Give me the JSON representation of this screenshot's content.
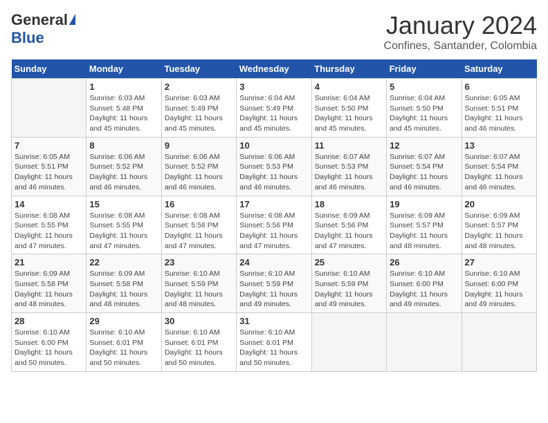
{
  "logo": {
    "general": "General",
    "blue": "Blue"
  },
  "title": "January 2024",
  "subtitle": "Confines, Santander, Colombia",
  "days_of_week": [
    "Sunday",
    "Monday",
    "Tuesday",
    "Wednesday",
    "Thursday",
    "Friday",
    "Saturday"
  ],
  "weeks": [
    [
      {
        "num": "",
        "info": ""
      },
      {
        "num": "1",
        "info": "Sunrise: 6:03 AM\nSunset: 5:48 PM\nDaylight: 11 hours\nand 45 minutes."
      },
      {
        "num": "2",
        "info": "Sunrise: 6:03 AM\nSunset: 5:49 PM\nDaylight: 11 hours\nand 45 minutes."
      },
      {
        "num": "3",
        "info": "Sunrise: 6:04 AM\nSunset: 5:49 PM\nDaylight: 11 hours\nand 45 minutes."
      },
      {
        "num": "4",
        "info": "Sunrise: 6:04 AM\nSunset: 5:50 PM\nDaylight: 11 hours\nand 45 minutes."
      },
      {
        "num": "5",
        "info": "Sunrise: 6:04 AM\nSunset: 5:50 PM\nDaylight: 11 hours\nand 45 minutes."
      },
      {
        "num": "6",
        "info": "Sunrise: 6:05 AM\nSunset: 5:51 PM\nDaylight: 11 hours\nand 46 minutes."
      }
    ],
    [
      {
        "num": "7",
        "info": "Sunrise: 6:05 AM\nSunset: 5:51 PM\nDaylight: 11 hours\nand 46 minutes."
      },
      {
        "num": "8",
        "info": "Sunrise: 6:06 AM\nSunset: 5:52 PM\nDaylight: 11 hours\nand 46 minutes."
      },
      {
        "num": "9",
        "info": "Sunrise: 6:06 AM\nSunset: 5:52 PM\nDaylight: 11 hours\nand 46 minutes."
      },
      {
        "num": "10",
        "info": "Sunrise: 6:06 AM\nSunset: 5:53 PM\nDaylight: 11 hours\nand 46 minutes."
      },
      {
        "num": "11",
        "info": "Sunrise: 6:07 AM\nSunset: 5:53 PM\nDaylight: 11 hours\nand 46 minutes."
      },
      {
        "num": "12",
        "info": "Sunrise: 6:07 AM\nSunset: 5:54 PM\nDaylight: 11 hours\nand 46 minutes."
      },
      {
        "num": "13",
        "info": "Sunrise: 6:07 AM\nSunset: 5:54 PM\nDaylight: 11 hours\nand 46 minutes."
      }
    ],
    [
      {
        "num": "14",
        "info": "Sunrise: 6:08 AM\nSunset: 5:55 PM\nDaylight: 11 hours\nand 47 minutes."
      },
      {
        "num": "15",
        "info": "Sunrise: 6:08 AM\nSunset: 5:55 PM\nDaylight: 11 hours\nand 47 minutes."
      },
      {
        "num": "16",
        "info": "Sunrise: 6:08 AM\nSunset: 5:56 PM\nDaylight: 11 hours\nand 47 minutes."
      },
      {
        "num": "17",
        "info": "Sunrise: 6:08 AM\nSunset: 5:56 PM\nDaylight: 11 hours\nand 47 minutes."
      },
      {
        "num": "18",
        "info": "Sunrise: 6:09 AM\nSunset: 5:56 PM\nDaylight: 11 hours\nand 47 minutes."
      },
      {
        "num": "19",
        "info": "Sunrise: 6:09 AM\nSunset: 5:57 PM\nDaylight: 11 hours\nand 48 minutes."
      },
      {
        "num": "20",
        "info": "Sunrise: 6:09 AM\nSunset: 5:57 PM\nDaylight: 11 hours\nand 48 minutes."
      }
    ],
    [
      {
        "num": "21",
        "info": "Sunrise: 6:09 AM\nSunset: 5:58 PM\nDaylight: 11 hours\nand 48 minutes."
      },
      {
        "num": "22",
        "info": "Sunrise: 6:09 AM\nSunset: 5:58 PM\nDaylight: 11 hours\nand 48 minutes."
      },
      {
        "num": "23",
        "info": "Sunrise: 6:10 AM\nSunset: 5:59 PM\nDaylight: 11 hours\nand 48 minutes."
      },
      {
        "num": "24",
        "info": "Sunrise: 6:10 AM\nSunset: 5:59 PM\nDaylight: 11 hours\nand 49 minutes."
      },
      {
        "num": "25",
        "info": "Sunrise: 6:10 AM\nSunset: 5:59 PM\nDaylight: 11 hours\nand 49 minutes."
      },
      {
        "num": "26",
        "info": "Sunrise: 6:10 AM\nSunset: 6:00 PM\nDaylight: 11 hours\nand 49 minutes."
      },
      {
        "num": "27",
        "info": "Sunrise: 6:10 AM\nSunset: 6:00 PM\nDaylight: 11 hours\nand 49 minutes."
      }
    ],
    [
      {
        "num": "28",
        "info": "Sunrise: 6:10 AM\nSunset: 6:00 PM\nDaylight: 11 hours\nand 50 minutes."
      },
      {
        "num": "29",
        "info": "Sunrise: 6:10 AM\nSunset: 6:01 PM\nDaylight: 11 hours\nand 50 minutes."
      },
      {
        "num": "30",
        "info": "Sunrise: 6:10 AM\nSunset: 6:01 PM\nDaylight: 11 hours\nand 50 minutes."
      },
      {
        "num": "31",
        "info": "Sunrise: 6:10 AM\nSunset: 6:01 PM\nDaylight: 11 hours\nand 50 minutes."
      },
      {
        "num": "",
        "info": ""
      },
      {
        "num": "",
        "info": ""
      },
      {
        "num": "",
        "info": ""
      }
    ]
  ]
}
